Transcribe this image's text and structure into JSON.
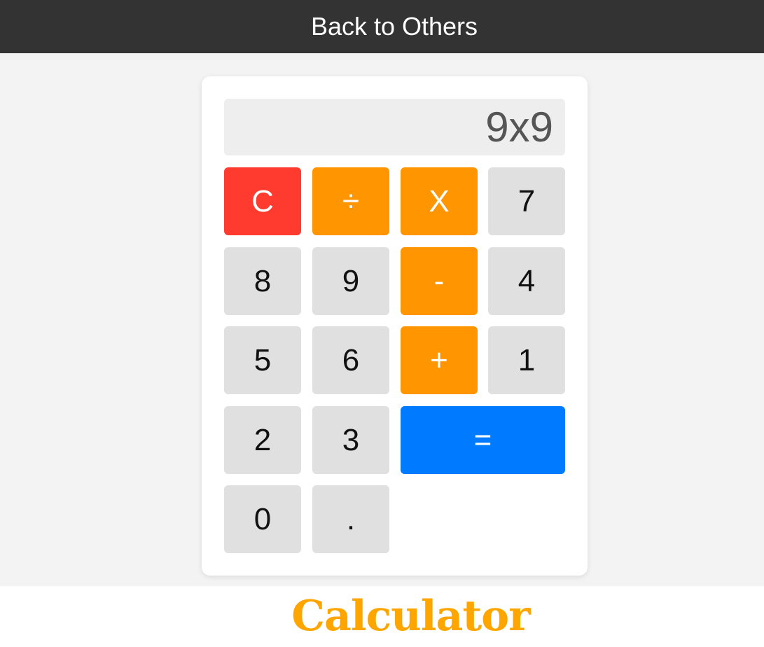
{
  "nav": {
    "back_label": "Back to Others"
  },
  "display": {
    "value": "9x9"
  },
  "buttons": {
    "clear": "C",
    "divide": "÷",
    "multiply": "X",
    "seven": "7",
    "eight": "8",
    "nine": "9",
    "minus": "-",
    "four": "4",
    "five": "5",
    "six": "6",
    "plus": "+",
    "one": "1",
    "two": "2",
    "three": "3",
    "equals": "=",
    "zero": "0",
    "decimal": "."
  },
  "footer": {
    "title": "Calculator"
  },
  "colors": {
    "clear": "#ff3b30",
    "operator": "#ff9500",
    "equals": "#007bff",
    "digit": "#e0e0e0",
    "title": "#ffa500",
    "nav": "#333333"
  }
}
